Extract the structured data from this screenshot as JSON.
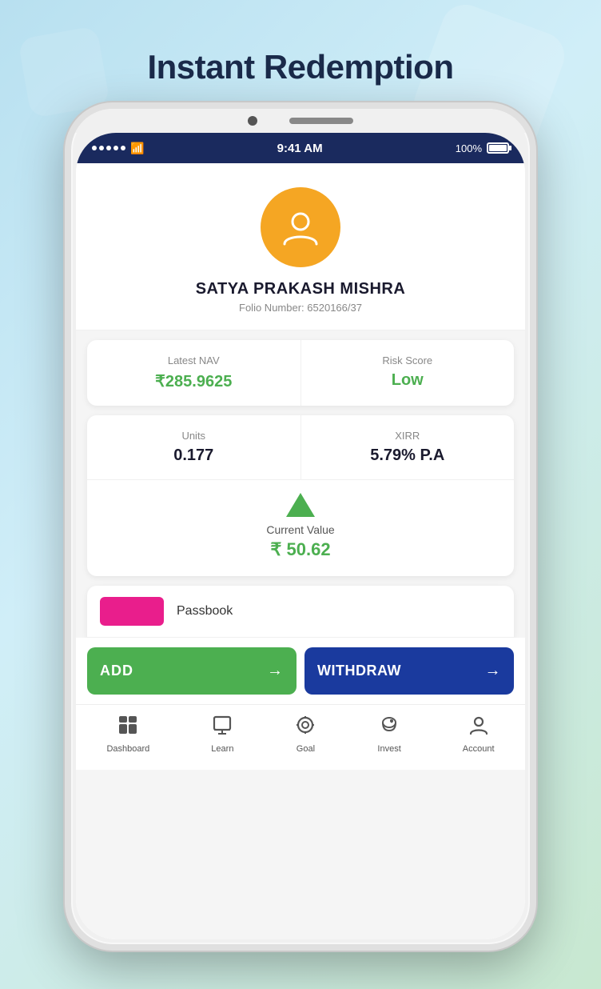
{
  "page": {
    "title": "Instant Redemption"
  },
  "status_bar": {
    "time": "9:41 AM",
    "battery": "100%"
  },
  "profile": {
    "name": "SATYA PRAKASH MISHRA",
    "folio_label": "Folio Number:",
    "folio_number": "6520166/37"
  },
  "nav_label": {
    "latest_nav": "Latest NAV",
    "nav_value": "₹285.9625",
    "risk_score": "Risk Score",
    "risk_value": "Low"
  },
  "holdings": {
    "units_label": "Units",
    "units_value": "0.177",
    "xirr_label": "XIRR",
    "xirr_value": "5.79% P.A"
  },
  "current_value": {
    "label": "Current Value",
    "amount": "₹ 50.62"
  },
  "passbook": {
    "label": "Passbook"
  },
  "buttons": {
    "add": "ADD",
    "withdraw": "WITHDRAW"
  },
  "bottom_nav": {
    "items": [
      {
        "label": "Dashboard",
        "icon": "⊞"
      },
      {
        "label": "Learn",
        "icon": "⬜"
      },
      {
        "label": "Goal",
        "icon": "◎"
      },
      {
        "label": "Invest",
        "icon": "🐷"
      },
      {
        "label": "Account",
        "icon": "👤"
      }
    ]
  }
}
